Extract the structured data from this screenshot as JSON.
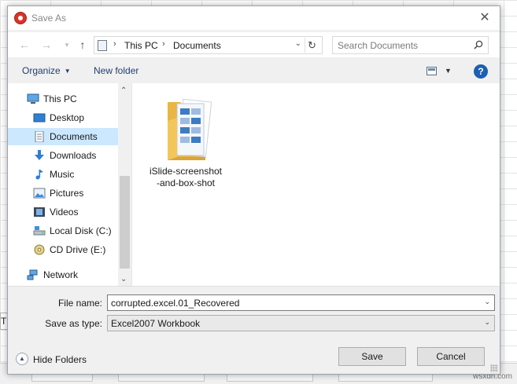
{
  "window": {
    "title": "Save As",
    "close_glyph": "✕"
  },
  "address": {
    "segments": [
      "This PC",
      "Documents"
    ],
    "separator": "›"
  },
  "search": {
    "placeholder": "Search Documents",
    "value": ""
  },
  "toolbar": {
    "organize_label": "Organize",
    "new_folder_label": "New folder",
    "help_glyph": "?"
  },
  "nav": {
    "items": [
      {
        "label": "This PC",
        "icon": "monitor-icon",
        "selected": false
      },
      {
        "label": "Desktop",
        "icon": "desktop-icon",
        "selected": false
      },
      {
        "label": "Documents",
        "icon": "documents-icon",
        "selected": true
      },
      {
        "label": "Downloads",
        "icon": "download-arrow-icon",
        "selected": false
      },
      {
        "label": "Music",
        "icon": "music-note-icon",
        "selected": false
      },
      {
        "label": "Pictures",
        "icon": "pictures-icon",
        "selected": false
      },
      {
        "label": "Videos",
        "icon": "film-icon",
        "selected": false
      },
      {
        "label": "Local Disk (C:)",
        "icon": "hard-drive-icon",
        "selected": false
      },
      {
        "label": "CD Drive (E:)",
        "icon": "cd-drive-icon",
        "selected": false
      },
      {
        "label": "Network",
        "icon": "network-icon",
        "selected": false
      }
    ]
  },
  "files": {
    "items": [
      {
        "name_line1": "iSlide-screenshot",
        "name_line2": "-and-box-shot",
        "icon": "folder-icon"
      }
    ]
  },
  "form": {
    "file_name_label": "File name:",
    "file_name_value": "corrupted.excel.01_Recovered",
    "save_type_label": "Save as type:",
    "save_type_value": "Excel2007 Workbook"
  },
  "footer": {
    "hide_folders_label": "Hide Folders",
    "save_label": "Save",
    "cancel_label": "Cancel"
  },
  "background": {
    "left_stub_text": "TC",
    "watermark": "wsxdn.com"
  },
  "colors": {
    "accent": "#1e3e74",
    "selection": "#cce8ff",
    "help": "#1d5fb2",
    "folder": "#f3c65b"
  }
}
